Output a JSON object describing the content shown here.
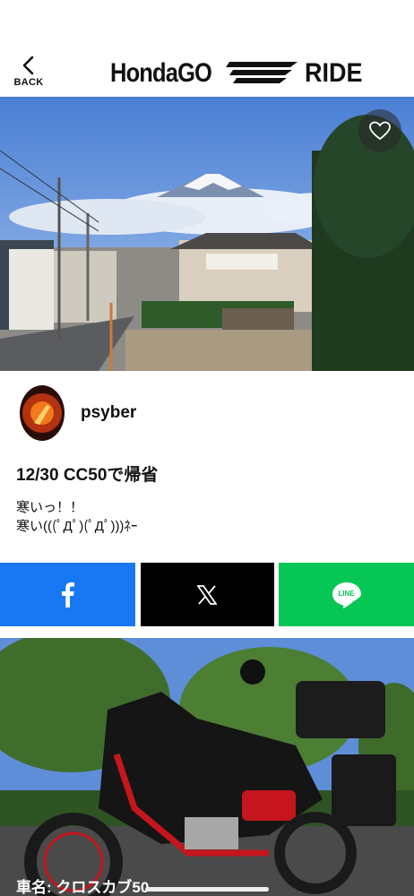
{
  "header": {
    "back_label": "BACK",
    "logo_text_left": "HondaGO",
    "logo_text_right": "RIDE"
  },
  "post": {
    "username": "psyber",
    "title": "12/30 CC50で帰省",
    "body": "寒いっ！！\n寒い(((ﾟДﾟ)(ﾟДﾟ)))ﾈｰ",
    "caption": "車名: クロスカブ50"
  },
  "share": {
    "line_label": "LINE"
  },
  "icons": {
    "back": "chevron-left-icon",
    "favorite": "heart-icon",
    "facebook": "facebook-icon",
    "x": "x-logo-icon",
    "line": "line-logo-icon"
  },
  "colors": {
    "facebook": "#1877f2",
    "x": "#000000",
    "line": "#06c755"
  }
}
